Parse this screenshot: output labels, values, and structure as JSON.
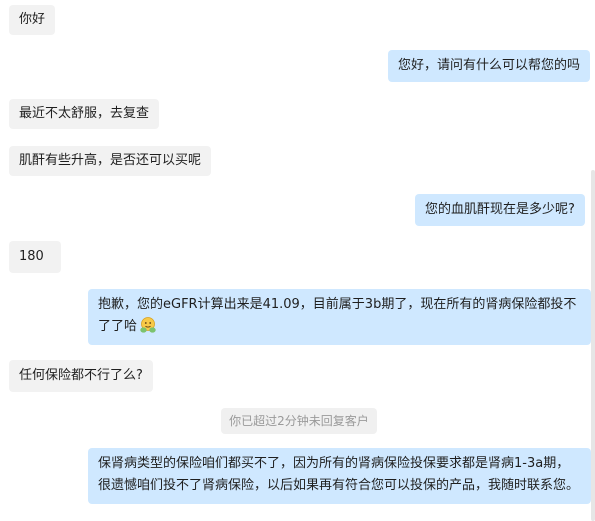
{
  "messages": [
    {
      "side": "in",
      "text": "你好"
    },
    {
      "side": "out",
      "text": "您好，请问有什么可以帮您的吗"
    },
    {
      "side": "in",
      "text": "最近不太舒服，去复查"
    },
    {
      "side": "in",
      "text": "肌酐有些升高，是否还可以买呢"
    },
    {
      "side": "out",
      "text": "您的血肌酐现在是多少呢?"
    },
    {
      "side": "in",
      "text": "180"
    },
    {
      "side": "out",
      "line1": "抱歉，您的eGFR计算出来是41.09，目前属于3b期了，现在所有的肾病保险都投不",
      "line2": "了了哈",
      "emoji": "face-with-hands-emoji"
    },
    {
      "side": "in",
      "text": "任何保险都不行了么?"
    },
    {
      "side": "out",
      "line1": "保肾病类型的保险咱们都买不了，因为所有的肾病保险投保要求都是肾病1-3a期，",
      "line2": "很遗憾咱们投不了肾病保险，以后如果再有符合您可以投保的产品，我随时联系您。"
    }
  ],
  "system_notice": "你已超过2分钟未回复客户",
  "colors": {
    "incoming_bubble": "#f2f2f2",
    "outgoing_bubble": "#cfe8ff",
    "system_text": "#9a9a9a"
  }
}
